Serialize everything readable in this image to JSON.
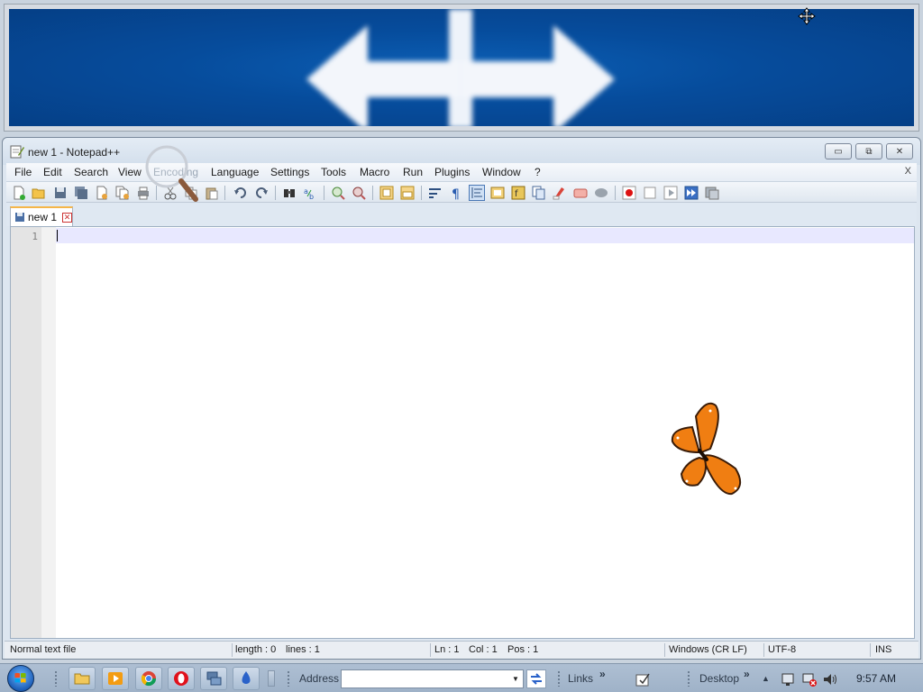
{
  "window": {
    "title": "new 1 - Notepad++",
    "buttons": {
      "minimize": "▭",
      "restore": "⧉",
      "close": "✕"
    }
  },
  "menu": {
    "items": [
      "File",
      "Edit",
      "Search",
      "View",
      "Encoding",
      "Language",
      "Settings",
      "Tools",
      "Macro",
      "Run",
      "Plugins",
      "Window",
      "?"
    ],
    "close": "X"
  },
  "tabs": [
    {
      "label": "new 1",
      "active": true
    }
  ],
  "editor": {
    "line_numbers": [
      "1"
    ],
    "content": ""
  },
  "status": {
    "file_type": "Normal text file",
    "length": "length : 0",
    "lines": "lines : 1",
    "ln": "Ln : 1",
    "col": "Col : 1",
    "pos": "Pos : 1",
    "eol": "Windows (CR LF)",
    "encoding": "UTF-8",
    "mode": "INS"
  },
  "taskbar": {
    "address_label": "Address",
    "address_value": "",
    "links_label": "Links",
    "desktop_label": "Desktop",
    "chevron": "»",
    "clock": "9:57 AM"
  },
  "colors": {
    "banner_blue": "#064c9c",
    "tab_accent": "#f5b64a",
    "current_line": "#e8e8ff"
  }
}
